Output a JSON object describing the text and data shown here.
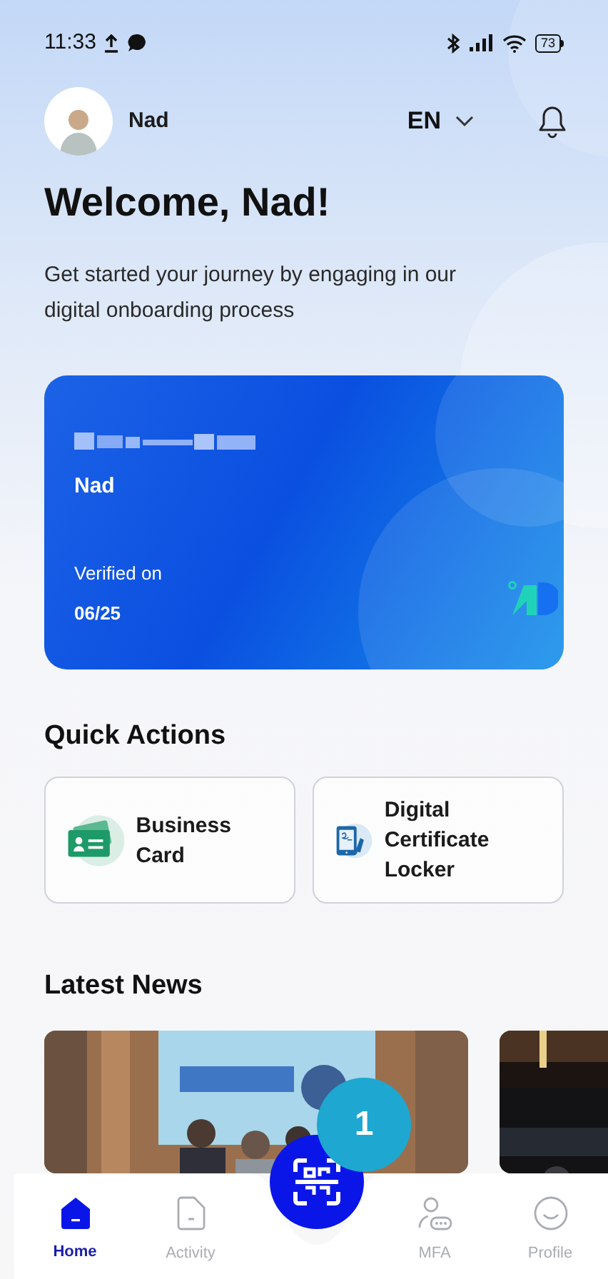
{
  "status_bar": {
    "time": "11:33",
    "battery": "73"
  },
  "header": {
    "user_name": "Nad",
    "language": "EN"
  },
  "welcome": {
    "title": "Welcome, Nad!",
    "subtitle": "Get started your journey by engaging in our digital onboarding process"
  },
  "id_card": {
    "name": "Nad",
    "verified_label": "Verified on",
    "verified_date": "06/25"
  },
  "quick_actions": {
    "title": "Quick Actions",
    "items": [
      {
        "label": "Business Card",
        "kind": "business-card"
      },
      {
        "label": "Digital Certificate Locker",
        "kind": "certificate"
      }
    ]
  },
  "latest_news": {
    "title": "Latest News"
  },
  "scan_button": {
    "badge": "1"
  },
  "nav": {
    "items": [
      {
        "label": "Home",
        "kind": "home",
        "selected": true
      },
      {
        "label": "Activity",
        "kind": "activity",
        "selected": false
      },
      {
        "label": "MFA",
        "kind": "mfa",
        "selected": false
      },
      {
        "label": "Profile",
        "kind": "profile",
        "selected": false
      }
    ]
  }
}
